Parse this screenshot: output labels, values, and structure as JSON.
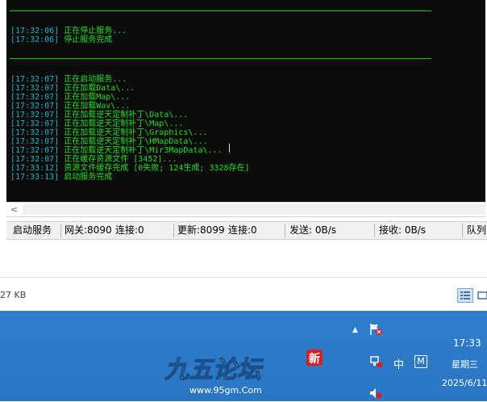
{
  "console": {
    "lines": [
      {
        "ts": "[17:32:06]",
        "text": " 正在停止服务..."
      },
      {
        "ts": "[17:32:06]",
        "text": " 停止服务完成"
      },
      {
        "ts": "[17:32:07]",
        "text": " 正在启动服务..."
      },
      {
        "ts": "[17:32:07]",
        "text": " 正在加载Data\\..."
      },
      {
        "ts": "[17:32:07]",
        "text": " 正在加载Map\\..."
      },
      {
        "ts": "[17:32:07]",
        "text": " 正在加载Wav\\..."
      },
      {
        "ts": "[17:32:07]",
        "text": " 正在加载逆天定制补丁\\Data\\..."
      },
      {
        "ts": "[17:32:07]",
        "text": " 正在加载逆天定制补丁\\Map\\..."
      },
      {
        "ts": "[17:32:07]",
        "text": " 正在加载逆天定制补丁\\Graphics\\..."
      },
      {
        "ts": "[17:32:07]",
        "text": " 正在加载逆天定制补丁\\HMapData\\..."
      },
      {
        "ts": "[17:32:07]",
        "text": " 正在加载逆天定制补丁\\Mir3MapData\\..."
      },
      {
        "ts": "[17:32:07]",
        "text": " 正在缓存资源文件 [3452]..."
      },
      {
        "ts": "[17:33:12]",
        "text": " 资源文件缓存完成 [0失败; 124生成; 3328存在]"
      },
      {
        "ts": "[17:33:13]",
        "text": " 启动服务完成"
      }
    ]
  },
  "hscroll": {
    "left_arrow": "<"
  },
  "status": {
    "state": "启动服务",
    "gateway": "网关:8090",
    "gateway_conn": "连接:0",
    "update": "更新:8099",
    "update_conn": "连接:0",
    "send": "发送: 0B/s",
    "recv": "接收: 0B/s",
    "queue": "队列"
  },
  "explorer": {
    "size_text": "27 KB"
  },
  "taskbar": {
    "time": "17:33",
    "weekday": "星期三",
    "date": "2025/6/11",
    "ime": "中",
    "ime_mode": "M",
    "logo_text": "九五论坛",
    "logo_badge": "新",
    "logo_url": "www.95gm.Com"
  },
  "colors": {
    "console_bg": "#0c0c0c",
    "console_text": "#21e021",
    "timestamp": "#19b4c8",
    "taskbar": "#2f7fcc"
  }
}
